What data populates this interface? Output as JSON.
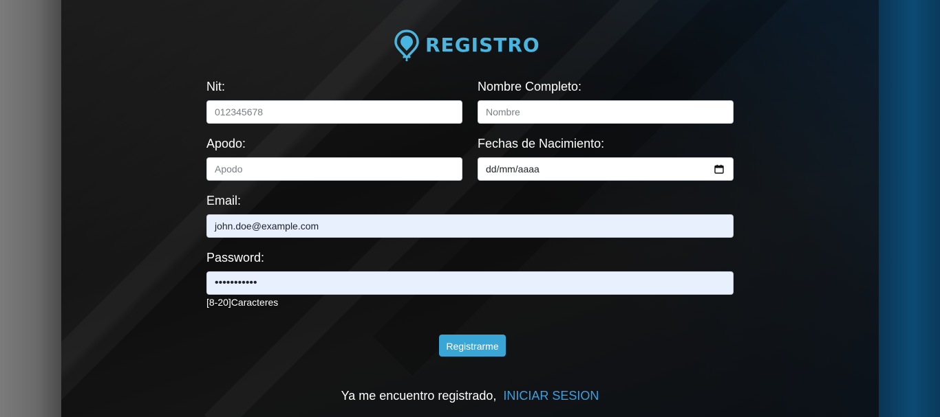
{
  "logo": {
    "text": "REGISTRO",
    "icon": "location-pin-icon",
    "color": "#4ab6e0"
  },
  "form": {
    "nit": {
      "label": "Nit:",
      "placeholder": "012345678",
      "value": ""
    },
    "nombre": {
      "label": "Nombre Completo:",
      "placeholder": "Nombre",
      "value": ""
    },
    "apodo": {
      "label": "Apodo:",
      "placeholder": "Apodo",
      "value": ""
    },
    "fecha": {
      "label": "Fechas de Nacimiento:",
      "placeholder": "dd/mm/aaaa",
      "icon": "calendar-icon"
    },
    "email": {
      "label": "Email:",
      "value": "john.doe@example.com"
    },
    "password": {
      "label": "Password:",
      "value": "•••••••••••",
      "helper": "[8-20]Caracteres"
    },
    "submit_label": "Registrarme"
  },
  "footer": {
    "text": "Ya me encuentro registrado,",
    "link": "INICIAR SESION"
  },
  "colors": {
    "accent": "#3aa6d6",
    "link": "#3aa0e0",
    "autofill_bg": "#e8f0fe"
  }
}
